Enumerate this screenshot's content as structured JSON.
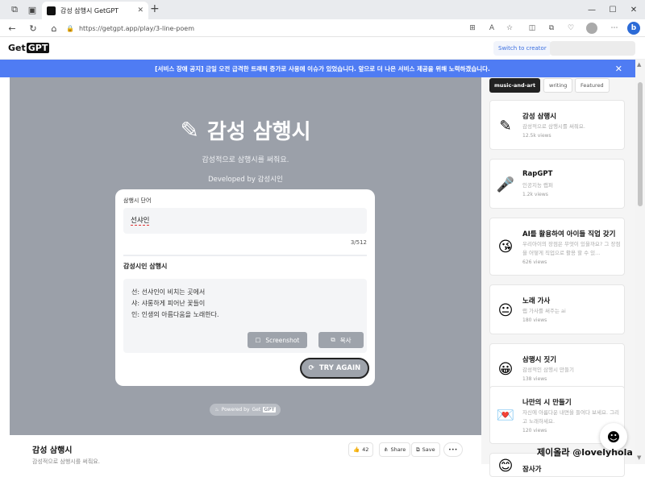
{
  "browser": {
    "tab_title": "감성 삼행시 GetGPT",
    "url": "https://getgpt.app/play/3-line-poem"
  },
  "site": {
    "logo_text": "Get",
    "logo_badge": "GPT",
    "switch_creator": "Switch to creator",
    "notice": "[서비스 장애 공지] 금일 오전 급격한 트래픽 증가로 사용에 이슈가 있었습니다. 앞으로 더 나은 서비스 제공을 위해 노력하겠습니다."
  },
  "hero": {
    "title": "감성 삼행시",
    "subtitle": "감성적으로 삼행시를 써줘요.",
    "developer": "Developed by 감성시인"
  },
  "form": {
    "input_label": "삼행시 단어",
    "input_value": "선샤인",
    "char_count": "3/512",
    "output_label": "감성시인 삼행시",
    "output_lines": [
      "선: 선샤인이 비치는 곳에서",
      "샤: 샤롱하게 피어난 꽃들이",
      "인: 인생의 아름다움을 노래한다."
    ],
    "screenshot_label": "Screenshot",
    "copy_label": "복사",
    "try_again_label": "TRY AGAIN"
  },
  "powered": {
    "prefix": "Powered by",
    "brand": "Get",
    "badge": "GPT"
  },
  "bottom": {
    "title": "감성 삼행시",
    "subtitle": "감성적으로 삼행시를 써줘요.",
    "likes": "42",
    "share_label": "Share",
    "save_label": "Save"
  },
  "sidebar": {
    "categories": [
      "music-and-art",
      "writing",
      "Featured"
    ],
    "items": [
      {
        "name": "감성 삼행시",
        "desc": "감성적으로 삼행시를 써줘요.",
        "views": "12.5k views",
        "icon": "pen-icon"
      },
      {
        "name": "RapGPT",
        "desc": "인공지능 랩퍼",
        "views": "1.2k views",
        "icon": "microphone-icon"
      },
      {
        "name": "AI를 활용하여 아이들 직업 갖기",
        "desc": "우리아이의 장점은 무엇이 있을까요? 그 장점을 어떻게 직업으로 활용 할 수 있...",
        "views": "626 views",
        "icon": "face-kiss-icon"
      },
      {
        "name": "노래 가사",
        "desc": "랩 가사를 써주는 ai",
        "views": "180 views",
        "icon": "face-neutral-icon"
      },
      {
        "name": "삼행시 짓기",
        "desc": "감성적인 삼행시 만들기",
        "views": "138 views",
        "icon": "face-grin-icon"
      },
      {
        "name": "나만의 시 만들기",
        "desc": "자신에 아름다운 내면을 들여다 보세요. 그리고 노래하세요.",
        "views": "120 views",
        "icon": "love-letter-icon"
      },
      {
        "name": "잠사가",
        "desc": "",
        "views": "",
        "icon": "face-icon"
      }
    ]
  },
  "watermark": "제이올라 @lovelyhola"
}
